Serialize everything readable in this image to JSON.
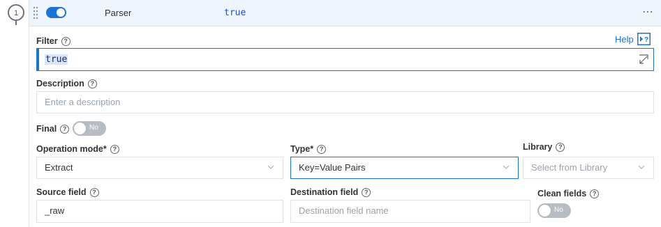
{
  "step": {
    "number": "1"
  },
  "header": {
    "title": "Parser",
    "filter": "true",
    "more": "⋯"
  },
  "help": {
    "label": "Help",
    "icon": "help-panel-icon"
  },
  "filter": {
    "label": "Filter",
    "value": "true"
  },
  "description": {
    "label": "Description",
    "placeholder": "Enter a description"
  },
  "final": {
    "label": "Final",
    "toggle_text": "No"
  },
  "operation_mode": {
    "label": "Operation mode*",
    "value": "Extract"
  },
  "type": {
    "label": "Type*",
    "value": "Key=Value Pairs"
  },
  "library": {
    "label": "Library",
    "placeholder": "Select from Library"
  },
  "source_field": {
    "label": "Source field",
    "value": "_raw"
  },
  "destination_field": {
    "label": "Destination field",
    "placeholder": "Destination field name"
  },
  "clean_fields": {
    "label": "Clean fields",
    "toggle_text": "No"
  },
  "colors": {
    "accent": "#1a73d6",
    "header_bg": "#eef5fc",
    "toggle_off": "#b8bdc3"
  }
}
